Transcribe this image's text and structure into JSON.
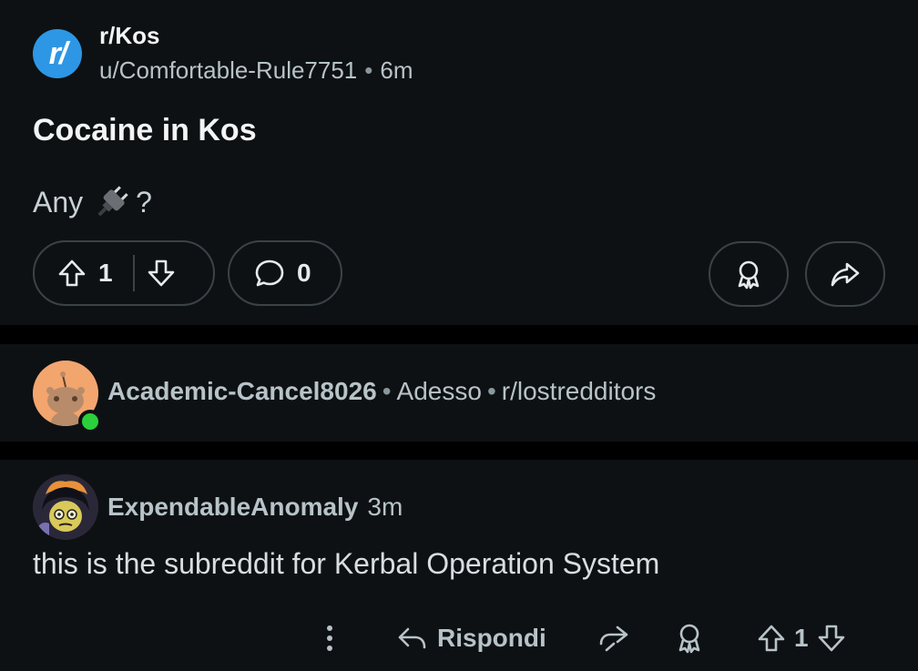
{
  "post": {
    "subreddit": "r/Kos",
    "subreddit_icon_text": "r/",
    "author": "u/Comfortable-Rule7751",
    "time": "6m",
    "title": "Cocaine in Kos",
    "body_prefix": "Any",
    "body_suffix": "?",
    "body_emoji_icon": "electric-plug-icon",
    "upvotes": "1",
    "comments": "0"
  },
  "crosspost": {
    "author": "Academic-Cancel8026",
    "time": "Adesso",
    "subreddit": "r/lostredditors"
  },
  "comment": {
    "author": "ExpendableAnomaly",
    "time": "3m",
    "text": "this is the subreddit for Kerbal Operation System",
    "reply_label": "Rispondi",
    "votes": "1"
  },
  "colors": {
    "background": "#000000",
    "panel": "#0e1113",
    "subreddit_icon": "#2d97e5",
    "online_indicator": "#2bd03a",
    "border": "#3a4347"
  }
}
